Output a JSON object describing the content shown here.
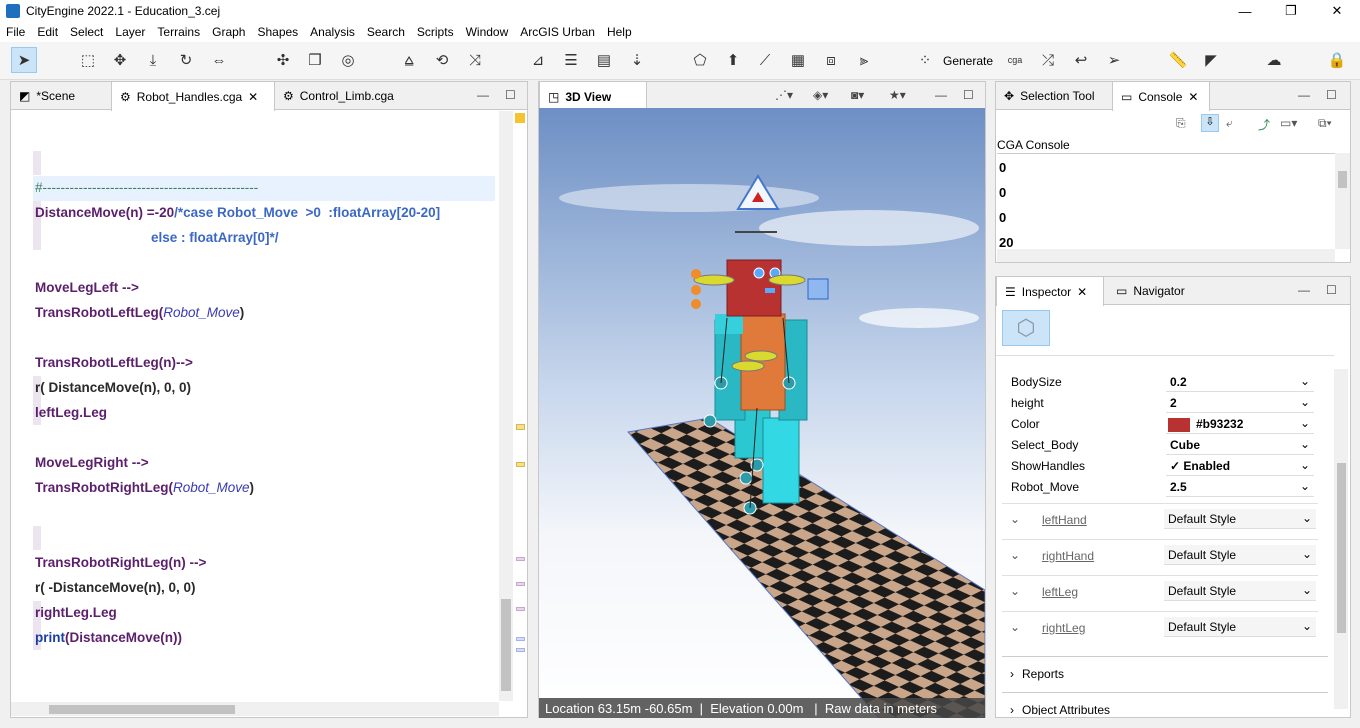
{
  "window": {
    "title": "CityEngine 2022.1 - Education_3.cej",
    "minimize": "—",
    "maximize": "❐",
    "close": "✕"
  },
  "menu": [
    "File",
    "Edit",
    "Select",
    "Layer",
    "Terrains",
    "Graph",
    "Shapes",
    "Analysis",
    "Search",
    "Scripts",
    "Window",
    "ArcGIS Urban",
    "Help"
  ],
  "toolbar": {
    "generate": "Generate",
    "cga": "cga"
  },
  "editor": {
    "tabs": [
      {
        "label": "*Scene"
      },
      {
        "label": "Robot_Handles.cga"
      },
      {
        "label": "Control_Limb.cga"
      }
    ],
    "lines": {
      "l1": "#------------------------------------------------",
      "l2a": "DistanceMove(n) =-20",
      "l2b": "/*case Robot_Move  >0  :floatArray[20-20]",
      "l3": "else : floatArray[0]*/",
      "l4": "MoveLegLeft -->",
      "l5a": "TransRobotLeftLeg(",
      "l5b": "Robot_Move",
      "l5c": ")",
      "l6": "TransRobotLeftLeg(n)-->",
      "l7": "r( DistanceMove(n), 0, 0)",
      "l8": "leftLeg.Leg",
      "l9": "MoveLegRight -->",
      "l10a": "TransRobotRightLeg(",
      "l10b": "Robot_Move",
      "l10c": ")",
      "l11": "TransRobotRightLeg(n) -->",
      "l12": "r( -DistanceMove(n), 0, 0)",
      "l13": "rightLeg.Leg",
      "l14a": "print",
      "l14b": "(DistanceMove(n))"
    }
  },
  "view3d": {
    "tab": "3D View",
    "status": "Location 63.15m -60.65m  |  Elevation 0.00m   |  Raw data in meters"
  },
  "console": {
    "tabs": [
      "Selection Tool",
      "Console"
    ],
    "header": "CGA Console",
    "lines": [
      "0",
      "0",
      "0",
      "20"
    ]
  },
  "inspector": {
    "tabs": [
      "Inspector",
      "Navigator"
    ],
    "props": [
      {
        "label": "BodySize",
        "value": "0.2"
      },
      {
        "label": "height",
        "value": "2"
      },
      {
        "label": "Color",
        "value": "#b93232",
        "color": "#b93232"
      },
      {
        "label": "Select_Body",
        "value": "Cube"
      },
      {
        "label": "ShowHandles",
        "value": "✓ Enabled"
      },
      {
        "label": "Robot_Move",
        "value": "2.5"
      }
    ],
    "styles": [
      {
        "label": "leftHand",
        "value": "Default Style"
      },
      {
        "label": "rightHand",
        "value": "Default Style"
      },
      {
        "label": "leftLeg",
        "value": "Default Style"
      },
      {
        "label": "rightLeg",
        "value": "Default Style"
      }
    ],
    "reports": "Reports",
    "object_attributes": "Object Attributes"
  }
}
